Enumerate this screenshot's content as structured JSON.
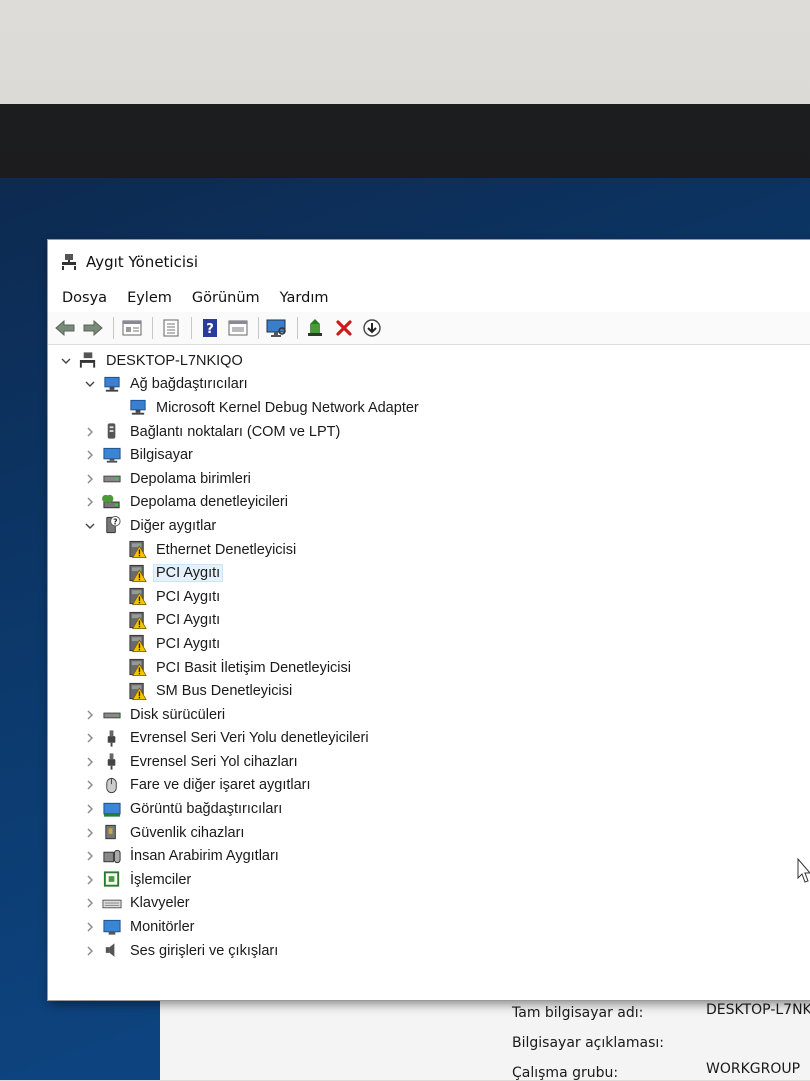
{
  "window": {
    "title": "Aygıt Yöneticisi"
  },
  "menu": [
    "Dosya",
    "Eylem",
    "Görünüm",
    "Yardım"
  ],
  "toolbar": {
    "buttons": [
      "back-icon",
      "forward-icon",
      "properties-icon",
      "view-icon",
      "help-icon",
      "resources-icon",
      "scan-hardware-icon",
      "update-driver-icon",
      "uninstall-icon",
      "download-icon"
    ]
  },
  "tree": {
    "root": "DESKTOP-L7NKIQO",
    "categories": [
      {
        "label": "Ağ bağdaştırıcıları",
        "expanded": true,
        "icon": "network-adapter-icon",
        "children": [
          "Microsoft Kernel Debug Network Adapter"
        ]
      },
      {
        "label": "Bağlantı noktaları (COM ve LPT)",
        "icon": "port-icon"
      },
      {
        "label": "Bilgisayar",
        "icon": "computer-icon"
      },
      {
        "label": "Depolama birimleri",
        "icon": "storage-volume-icon"
      },
      {
        "label": "Depolama denetleyicileri",
        "icon": "storage-controller-icon"
      },
      {
        "label": "Diğer aygıtlar",
        "expanded": true,
        "icon": "unknown-device-icon",
        "children": [
          "Ethernet Denetleyicisi",
          "PCI Aygıtı",
          "PCI Aygıtı",
          "PCI Aygıtı",
          "PCI Aygıtı",
          "PCI Basit İletişim Denetleyicisi",
          "SM Bus Denetleyicisi"
        ],
        "selected_child": 1
      },
      {
        "label": "Disk sürücüleri",
        "icon": "disk-drive-icon"
      },
      {
        "label": "Evrensel Seri Veri Yolu denetleyicileri",
        "icon": "usb-icon"
      },
      {
        "label": "Evrensel Seri Yol cihazları",
        "icon": "usb-icon"
      },
      {
        "label": "Fare ve diğer işaret aygıtları",
        "icon": "mouse-icon"
      },
      {
        "label": "Görüntü bağdaştırıcıları",
        "icon": "display-adapter-icon"
      },
      {
        "label": "Güvenlik cihazları",
        "icon": "security-device-icon"
      },
      {
        "label": "İnsan Arabirim Aygıtları",
        "icon": "hid-icon"
      },
      {
        "label": "İşlemciler",
        "icon": "processor-icon"
      },
      {
        "label": "Klavyeler",
        "icon": "keyboard-icon"
      },
      {
        "label": "Monitörler",
        "icon": "monitor-icon"
      },
      {
        "label": "Ses girişleri ve çıkışları",
        "icon": "audio-icon"
      }
    ]
  },
  "system_info": {
    "computer_name_label": "Tam bilgisayar adı:",
    "computer_name_value": "DESKTOP-L7NK",
    "description_label": "Bilgisayar açıklaması:",
    "workgroup_label": "Çalışma grubu:",
    "workgroup_value": "WORKGROUP"
  },
  "colors": {
    "warning": "#f5c400",
    "uninstall": "#d01a1a",
    "selection": "#e5f1fb"
  }
}
